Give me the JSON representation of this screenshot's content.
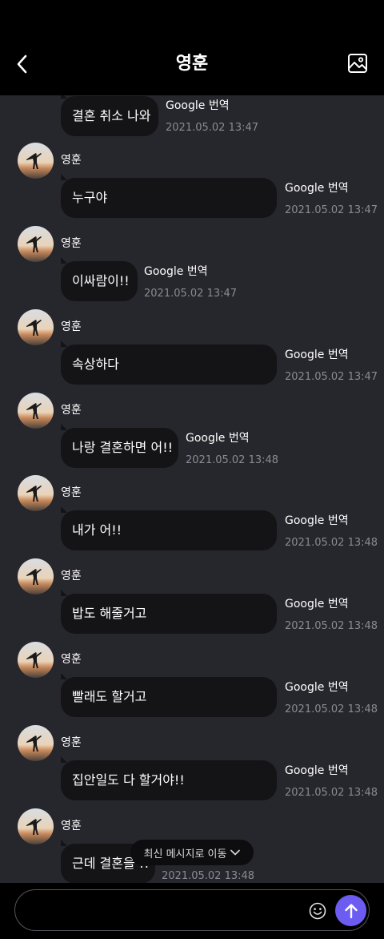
{
  "header": {
    "title": "영훈",
    "back_icon": "chevron-left-icon",
    "gallery_icon": "image-icon"
  },
  "messages": [
    {
      "sender": "",
      "text": "결혼 취소 나와",
      "translate": "Google 번역",
      "time": "2021.05.02 13:47"
    },
    {
      "sender": "영훈",
      "text": "누구야",
      "translate": "Google 번역",
      "time": "2021.05.02 13:47"
    },
    {
      "sender": "영훈",
      "text": "이싸람이!!",
      "translate": "Google 번역",
      "time": "2021.05.02 13:47"
    },
    {
      "sender": "영훈",
      "text": "속상하다",
      "translate": "Google 번역",
      "time": "2021.05.02 13:47"
    },
    {
      "sender": "영훈",
      "text": "나랑 결혼하면 어!!",
      "translate": "Google 번역",
      "time": "2021.05.02 13:48"
    },
    {
      "sender": "영훈",
      "text": "내가 어!!",
      "translate": "Google 번역",
      "time": "2021.05.02 13:48"
    },
    {
      "sender": "영훈",
      "text": "밥도 해줄거고",
      "translate": "Google 번역",
      "time": "2021.05.02 13:48"
    },
    {
      "sender": "영훈",
      "text": "빨래도 할거고",
      "translate": "Google 번역",
      "time": "2021.05.02 13:48"
    },
    {
      "sender": "영훈",
      "text": "집안일도 다 할거야!!",
      "translate": "Google 번역",
      "time": "2021.05.02 13:48"
    },
    {
      "sender": "영훈",
      "text": "근데 결혼을 !!",
      "translate": "",
      "time": "2021.05.02 13:48"
    }
  ],
  "jump_to_latest": {
    "label": "최신 메시지로 이동",
    "icon": "chevron-down-icon"
  },
  "composer": {
    "placeholder": "",
    "emoji_icon": "smile-icon",
    "send_icon": "arrow-up-icon",
    "accent_color": "#6c5cf2"
  }
}
